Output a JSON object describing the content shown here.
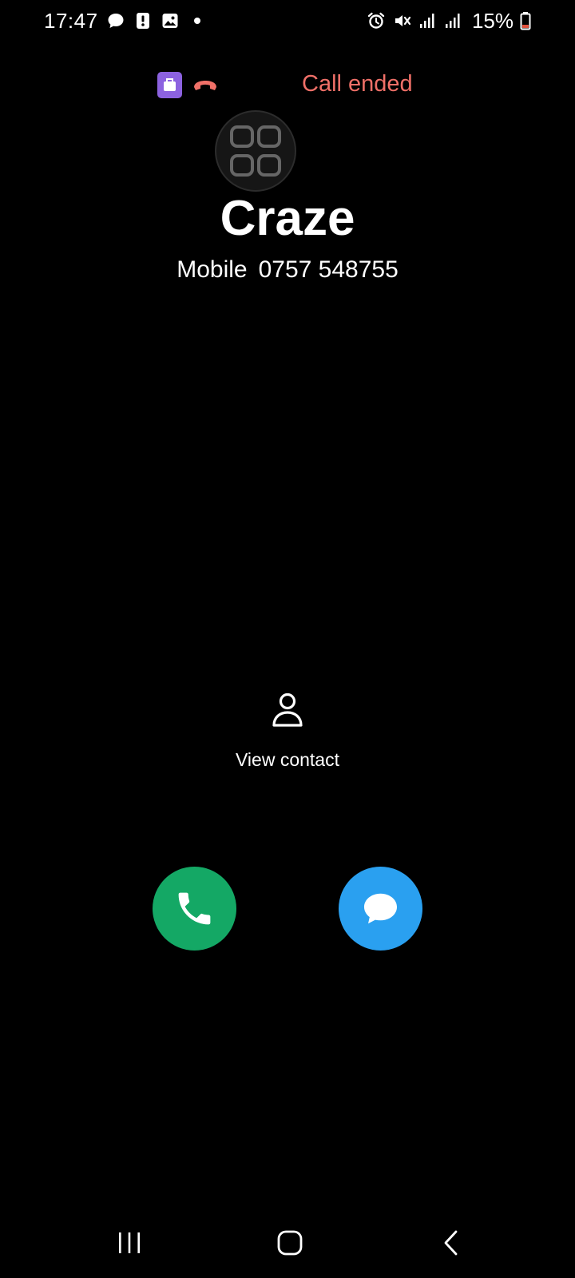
{
  "status_bar": {
    "time": "17:47",
    "battery": "15%",
    "left_icons": [
      "chat-bubble-icon",
      "alert-icon",
      "gallery-icon",
      "dot-icon"
    ],
    "right_icons": [
      "alarm-icon",
      "vibrate-mute-icon",
      "signal-icon",
      "signal-icon",
      "battery-low-icon"
    ]
  },
  "call": {
    "status": "Call ended",
    "status_color": "#f07068",
    "badge_color": "#8c62e0"
  },
  "contact": {
    "name": "Craze",
    "number_label": "Mobile",
    "number": "0757 548755"
  },
  "actions": {
    "view_contact_label": "View contact",
    "call_color": "#14a865",
    "message_color": "#2aa0f0"
  },
  "nav": {
    "items": [
      "recents-icon",
      "home-icon",
      "back-icon"
    ]
  }
}
